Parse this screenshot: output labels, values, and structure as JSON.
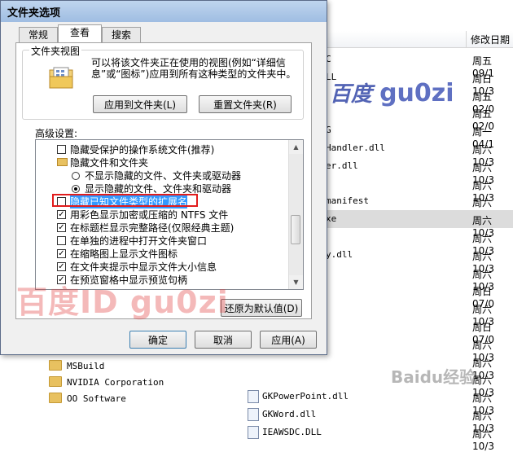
{
  "dialog": {
    "title": "文件夹选项",
    "tabs": [
      {
        "label": "常规"
      },
      {
        "label": "查看"
      },
      {
        "label": "搜索"
      }
    ],
    "folder_views": {
      "legend": "文件夹视图",
      "description": "可以将该文件夹正在使用的视图(例如“详细信息”或“图标”)应用到所有这种类型的文件夹中。",
      "apply_button": "应用到文件夹(L)",
      "reset_button": "重置文件夹(R)"
    },
    "advanced": {
      "label": "高级设置:",
      "items": [
        {
          "type": "checkbox",
          "checked": false,
          "indent": 1,
          "label": "隐藏受保护的操作系统文件(推荐)"
        },
        {
          "type": "folder",
          "indent": 1,
          "label": "隐藏文件和文件夹"
        },
        {
          "type": "radio",
          "checked": false,
          "indent": 2,
          "label": "不显示隐藏的文件、文件夹或驱动器"
        },
        {
          "type": "radio",
          "checked": true,
          "indent": 2,
          "label": "显示隐藏的文件、文件夹和驱动器"
        },
        {
          "type": "checkbox",
          "checked": false,
          "indent": 1,
          "label": "隐藏已知文件类型的扩展名",
          "selected": true
        },
        {
          "type": "checkbox",
          "checked": true,
          "indent": 1,
          "label": "用彩色显示加密或压缩的 NTFS 文件"
        },
        {
          "type": "checkbox",
          "checked": true,
          "indent": 1,
          "label": "在标题栏显示完整路径(仅限经典主题)"
        },
        {
          "type": "checkbox",
          "checked": false,
          "indent": 1,
          "label": "在单独的进程中打开文件夹窗口"
        },
        {
          "type": "checkbox",
          "checked": true,
          "indent": 1,
          "label": "在缩略图上显示文件图标"
        },
        {
          "type": "checkbox",
          "checked": true,
          "indent": 1,
          "label": "在文件夹提示中显示文件大小信息"
        },
        {
          "type": "checkbox",
          "checked": true,
          "indent": 1,
          "label": "在预览窗格中显示预览句柄"
        }
      ],
      "restore_button": "还原为默认值(D)"
    },
    "ok_button": "确定",
    "cancel_button": "取消",
    "apply_button": "应用(A)"
  },
  "explorer": {
    "column_header": "修改日期",
    "rows": [
      {
        "name": "C",
        "date": "周五 09/1"
      },
      {
        "name": "LL",
        "date": "周日 10/3"
      },
      {
        "name": "",
        "date": "周五 02/0"
      },
      {
        "name": "",
        "date": "周五 02/0"
      },
      {
        "name": "G",
        "date": "周一 04/1"
      },
      {
        "name": "Handler.dll",
        "date": "周六 10/3"
      },
      {
        "name": "er.dll",
        "date": "周六 10/3"
      },
      {
        "name": "",
        "date": "周六 10/3"
      },
      {
        "name": "manifest",
        "date": "周六 10/3"
      },
      {
        "name": "xe",
        "date": "周六 10/3",
        "selected": true
      },
      {
        "name": "",
        "date": "周六 10/3"
      },
      {
        "name": "y.dll",
        "date": "周六 10/3"
      },
      {
        "name": "",
        "date": "周六 10/3"
      },
      {
        "name": "",
        "date": "周日 07/0"
      },
      {
        "name": "",
        "date": "周六 10/3"
      },
      {
        "name": "",
        "date": "周日 07/0"
      },
      {
        "name": "",
        "date": "周六 10/3"
      },
      {
        "name": "",
        "date": "周六 10/3"
      },
      {
        "name": "",
        "date": "周六 10/3"
      },
      {
        "name": "GKPowerPoint.dll",
        "date": "周六 10/3"
      },
      {
        "name": "GKWord.dll",
        "date": "周六 10/3"
      },
      {
        "name": "IEAWSDC.DLL",
        "date": "周六 10/3"
      }
    ],
    "folders": [
      {
        "name": "MSBuild"
      },
      {
        "name": "NVIDIA Corporation"
      },
      {
        "name": "OO Software"
      }
    ]
  },
  "watermarks": {
    "top": "百度",
    "top_id": "gu0zi",
    "bottom": "百度ID gu0zi",
    "baidu": "Baidu经验"
  }
}
